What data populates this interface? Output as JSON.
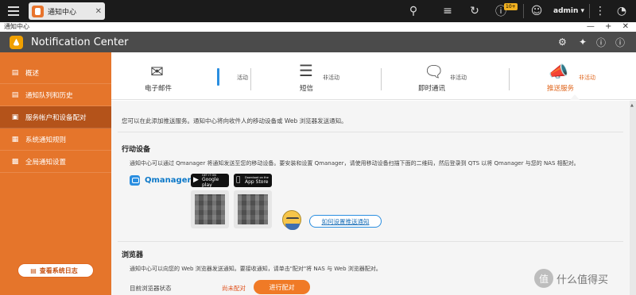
{
  "topbar": {
    "tab_title": "通知中心",
    "tab_close": "✕",
    "notification_badge": "10+",
    "user": "admin",
    "user_caret": "▾"
  },
  "window": {
    "title": "通知中心",
    "controls": "— + ✕"
  },
  "app": {
    "title": "Notification Center"
  },
  "sidebar": {
    "items": [
      {
        "label": "概述",
        "icon": "chart-icon"
      },
      {
        "label": "通知队列和历史",
        "icon": "list-icon"
      },
      {
        "label": "服务帐户和设备配对",
        "icon": "devices-icon"
      },
      {
        "label": "系统通知规则",
        "icon": "rules-icon"
      },
      {
        "label": "全局通知设置",
        "icon": "settings-icon"
      }
    ],
    "log_button": "查看系统日志"
  },
  "nav": {
    "tabs": [
      {
        "label": "电子邮件",
        "status": "活动",
        "icon": "mail-icon"
      },
      {
        "label": "短信",
        "status": "非活动",
        "icon": "sms-icon"
      },
      {
        "label": "即时通讯",
        "status": "非活动",
        "icon": "chat-icon"
      },
      {
        "label": "推送服务",
        "status": "非活动",
        "icon": "megaphone-icon"
      }
    ]
  },
  "main": {
    "intro": "您可以在此添加推送服务。通知中心将向收件人的移动设备或 Web 浏览器发送通知。",
    "mobile": {
      "heading": "行动设备",
      "desc": "通知中心可以通过 Qmanager 将通知发送至您的移动设备。要安装和设置 Qmanager，请使用移动设备扫描下面的二维码，然后登录到 QTS 以将 Qmanager 与您的 NAS 相配对。",
      "app_name": "Qmanager",
      "google_play_small": "GET IT ON",
      "google_play": "Google play",
      "app_store_small": "Download on the",
      "app_store": "App Store",
      "howto_link": "如何设置推送通知"
    },
    "browser": {
      "heading": "浏览器",
      "desc": "通知中心可以向您的 Web 浏览器发送通知。要接收通知，请单击\"配对\"将 NAS 与 Web 浏览器配对。",
      "status_label": "目前浏览器状态",
      "status_value": "尚未配对",
      "pair_button": "进行配对"
    }
  },
  "watermark": {
    "badge": "值",
    "text": "什么值得买"
  },
  "colors": {
    "accent": "#e5752b",
    "sidebar_active": "#b4531a",
    "topbar": "#1b1b1b",
    "appbar": "#4b4b4b",
    "link": "#1a6fb8"
  }
}
